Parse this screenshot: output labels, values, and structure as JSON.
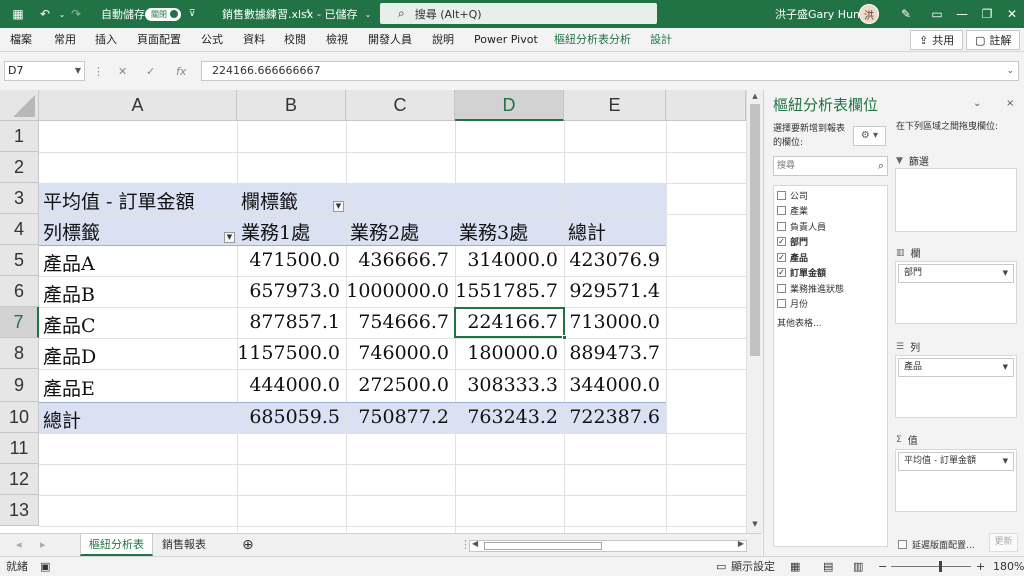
{
  "titlebar": {
    "autosave_label": "自動儲存",
    "autosave_state": "關閉",
    "filename": "銷售數據練習.xlsx",
    "saved_status": "- 已儲存",
    "search_placeholder": "搜尋 (Alt+Q)",
    "user_name": "洪子盛Gary Hung",
    "avatar_text": "洪"
  },
  "ribbon": {
    "tabs": [
      "檔案",
      "常用",
      "插入",
      "頁面配置",
      "公式",
      "資料",
      "校閱",
      "檢視",
      "開發人員",
      "說明",
      "Power Pivot",
      "樞紐分析表分析",
      "設計"
    ],
    "share_label": "共用",
    "comments_label": "註解"
  },
  "formula_bar": {
    "name_box": "D7",
    "formula": "224166.666666667"
  },
  "grid": {
    "columns": [
      "A",
      "B",
      "C",
      "D",
      "E"
    ],
    "rows": [
      "1",
      "2",
      "3",
      "4",
      "5",
      "6",
      "7",
      "8",
      "9",
      "10",
      "11",
      "12",
      "13"
    ],
    "pivot": {
      "title_value": "平均值 - 訂單金額",
      "col_labels": "欄標籤",
      "row_labels": "列標籤",
      "headers": [
        "業務1處",
        "業務2處",
        "業務3處",
        "總計"
      ],
      "rows": [
        {
          "label": "產品A",
          "values": [
            "471500.0",
            "436666.7",
            "314000.0",
            "423076.9"
          ]
        },
        {
          "label": "產品B",
          "values": [
            "657973.0",
            "1000000.0",
            "1551785.7",
            "929571.4"
          ]
        },
        {
          "label": "產品C",
          "values": [
            "877857.1",
            "754666.7",
            "224166.7",
            "713000.0"
          ]
        },
        {
          "label": "產品D",
          "values": [
            "1157500.0",
            "746000.0",
            "180000.0",
            "889473.7"
          ]
        },
        {
          "label": "產品E",
          "values": [
            "444000.0",
            "272500.0",
            "308333.3",
            "344000.0"
          ]
        }
      ],
      "total": {
        "label": "總計",
        "values": [
          "685059.5",
          "750877.2",
          "763243.2",
          "722387.6"
        ]
      }
    }
  },
  "sheets": {
    "tabs": [
      "樞紐分析表",
      "銷售報表"
    ],
    "active": "樞紐分析表"
  },
  "statusbar": {
    "ready": "就緒",
    "display_settings": "顯示設定",
    "zoom": "180%"
  },
  "pivot_pane": {
    "title": "樞紐分析表欄位",
    "choose_label": "選擇要新增到報表的欄位:",
    "drag_label": "在下列區域之間拖曳欄位:",
    "search_placeholder": "搜尋",
    "fields": [
      {
        "name": "公司",
        "checked": false
      },
      {
        "name": "產業",
        "checked": false
      },
      {
        "name": "負責人員",
        "checked": false
      },
      {
        "name": "部門",
        "checked": true
      },
      {
        "name": "產品",
        "checked": true
      },
      {
        "name": "訂單金額",
        "checked": true
      },
      {
        "name": "業務推進狀態",
        "checked": false
      },
      {
        "name": "月份",
        "checked": false
      }
    ],
    "more_tables": "其他表格...",
    "areas": {
      "filters": {
        "title": "篩選"
      },
      "columns": {
        "title": "欄",
        "item": "部門"
      },
      "rows": {
        "title": "列",
        "item": "產品"
      },
      "values": {
        "title": "值",
        "item": "平均值 - 訂單金額"
      }
    },
    "defer_label": "延遲版面配置...",
    "update_label": "更新"
  },
  "colors": {
    "accent": "#217346",
    "pivot_band": "#d9e1f2"
  }
}
